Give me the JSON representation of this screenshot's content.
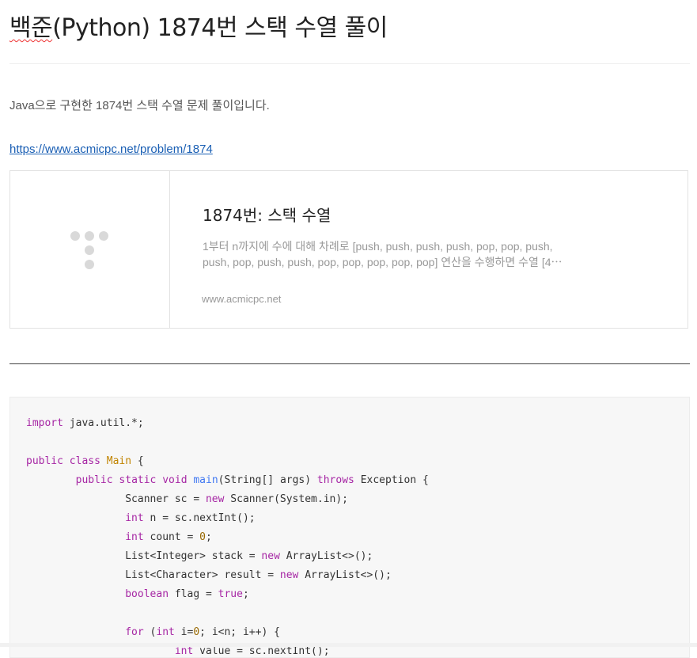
{
  "post": {
    "title_spell": "백준",
    "title_rest": "(Python) 1874번 스택 수열 풀이",
    "intro": "Java으로 구현한 1874번 스택 수열 문제 풀이입니다.",
    "link": "https://www.acmicpc.net/problem/1874"
  },
  "og_card": {
    "title": "1874번: 스택 수열",
    "description": "1부터 n까지에 수에 대해 차례로 [push, push, push, push, pop, pop, push, push, pop, push, push, pop, pop, pop, pop, pop] 연산을 수행하면 수열 [4⋯",
    "host": "www.acmicpc.net"
  },
  "code": {
    "lines": [
      [
        {
          "t": "import",
          "c": "kw"
        },
        {
          "t": " java.util.*;"
        }
      ],
      [],
      [
        {
          "t": "public",
          "c": "kw"
        },
        {
          "t": " "
        },
        {
          "t": "class",
          "c": "kw"
        },
        {
          "t": " "
        },
        {
          "t": "Main",
          "c": "cls"
        },
        {
          "t": " {"
        }
      ],
      [
        {
          "t": "        "
        },
        {
          "t": "public",
          "c": "kw"
        },
        {
          "t": " "
        },
        {
          "t": "static",
          "c": "kw"
        },
        {
          "t": " "
        },
        {
          "t": "void",
          "c": "kw"
        },
        {
          "t": " "
        },
        {
          "t": "main",
          "c": "fn"
        },
        {
          "t": "(String[] args) "
        },
        {
          "t": "throws",
          "c": "kw"
        },
        {
          "t": " Exception {"
        }
      ],
      [
        {
          "t": "                Scanner sc = "
        },
        {
          "t": "new",
          "c": "kw"
        },
        {
          "t": " Scanner(System.in);"
        }
      ],
      [
        {
          "t": "                "
        },
        {
          "t": "int",
          "c": "kw"
        },
        {
          "t": " n = sc.nextInt();"
        }
      ],
      [
        {
          "t": "                "
        },
        {
          "t": "int",
          "c": "kw"
        },
        {
          "t": " count = "
        },
        {
          "t": "0",
          "c": "num"
        },
        {
          "t": ";"
        }
      ],
      [
        {
          "t": "                List<Integer> stack = "
        },
        {
          "t": "new",
          "c": "kw"
        },
        {
          "t": " ArrayList<>();"
        }
      ],
      [
        {
          "t": "                List<Character> result = "
        },
        {
          "t": "new",
          "c": "kw"
        },
        {
          "t": " ArrayList<>();"
        }
      ],
      [
        {
          "t": "                "
        },
        {
          "t": "boolean",
          "c": "kw"
        },
        {
          "t": " flag = "
        },
        {
          "t": "true",
          "c": "kw"
        },
        {
          "t": ";"
        }
      ],
      [],
      [
        {
          "t": "                "
        },
        {
          "t": "for",
          "c": "kw"
        },
        {
          "t": " ("
        },
        {
          "t": "int",
          "c": "kw"
        },
        {
          "t": " i="
        },
        {
          "t": "0",
          "c": "num"
        },
        {
          "t": "; i<n; i++) {"
        }
      ],
      [
        {
          "t": "                        "
        },
        {
          "t": "int",
          "c": "kw"
        },
        {
          "t": " value = sc.nextInt();"
        }
      ]
    ]
  }
}
